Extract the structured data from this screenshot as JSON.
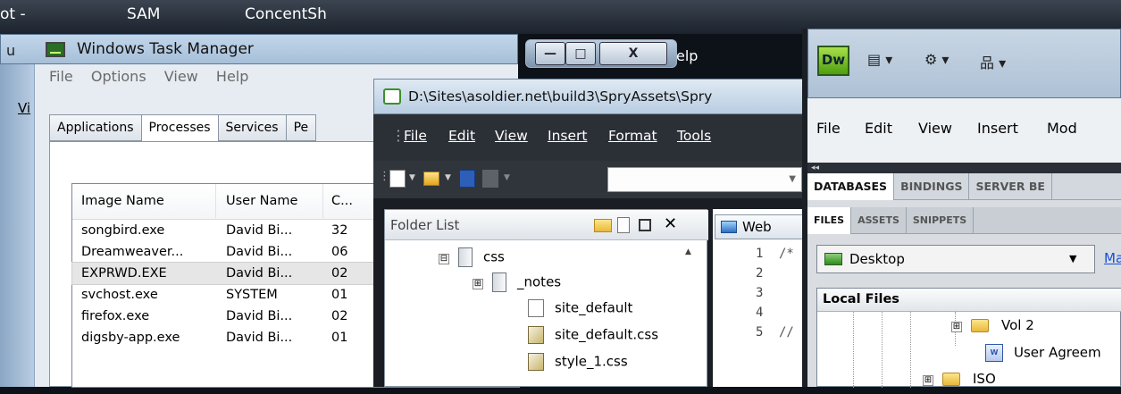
{
  "background_bar": {
    "items": [
      "ot -",
      "SAM",
      "ConcentSh"
    ]
  },
  "task_manager": {
    "title": "Windows Task Manager",
    "left_edge_text": "Vi",
    "left_edge_text2": "u",
    "menu": [
      "File",
      "Options",
      "View",
      "Help"
    ],
    "tabs": [
      "Applications",
      "Processes",
      "Services",
      "Pe"
    ],
    "active_tab": "Processes",
    "columns": [
      "Image Name",
      "User Name",
      "C..."
    ],
    "rows": [
      {
        "image": "songbird.exe",
        "user": "David Bi...",
        "cpu": "32"
      },
      {
        "image": "Dreamweaver...",
        "user": "David Bi...",
        "cpu": "06"
      },
      {
        "image": "EXPRWD.EXE",
        "user": "David Bi...",
        "cpu": "02"
      },
      {
        "image": "svchost.exe",
        "user": "SYSTEM",
        "cpu": "01"
      },
      {
        "image": "firefox.exe",
        "user": "David Bi...",
        "cpu": "02"
      },
      {
        "image": "digsby-app.exe",
        "user": "David Bi...",
        "cpu": "01"
      }
    ],
    "selected_row": "EXPRWD.EXE",
    "controls": {
      "minimize": "—",
      "maximize": "□",
      "close": "X"
    },
    "behind_text": "elp"
  },
  "expression_web": {
    "title": "D:\\Sites\\asoldier.net\\build3\\SpryAssets\\Spry",
    "menu": [
      "File",
      "Edit",
      "View",
      "Insert",
      "Format",
      "Tools"
    ],
    "folder_list": {
      "title": "Folder List",
      "items": [
        {
          "name": "css",
          "type": "folder",
          "expander": "⊟"
        },
        {
          "name": "_notes",
          "type": "folder",
          "expander": "⊞"
        },
        {
          "name": "site_default",
          "type": "file"
        },
        {
          "name": "site_default.css",
          "type": "css"
        },
        {
          "name": "style_1.css",
          "type": "css"
        }
      ]
    },
    "code_tab": "Web",
    "code_lines": [
      {
        "num": "1",
        "text": "/*"
      },
      {
        "num": "2",
        "text": ""
      },
      {
        "num": "3",
        "text": ""
      },
      {
        "num": "4",
        "text": ""
      },
      {
        "num": "5",
        "text": "//"
      }
    ]
  },
  "dreamweaver": {
    "logo": "Dw",
    "menu": [
      "File",
      "Edit",
      "View",
      "Insert",
      "Mod"
    ],
    "collapse_glyph": "◂◂",
    "panel_tabs_1": [
      "DATABASES",
      "BINDINGS",
      "SERVER BE"
    ],
    "panel_tabs_2": [
      "FILES",
      "ASSETS",
      "SNIPPETS"
    ],
    "site_select": "Desktop",
    "manage_link": "Ma",
    "local_files_header": "Local Files",
    "tree": [
      {
        "name": "Vol 2",
        "type": "folder",
        "expander": "⊞"
      },
      {
        "name": "User Agreem",
        "type": "doc"
      },
      {
        "name": "ISO",
        "type": "folder",
        "expander": "⊞"
      }
    ]
  },
  "colors": {
    "dw_green": "#6fbf24",
    "link_blue": "#1a4fd6",
    "titlebar": "#b9cde2"
  }
}
